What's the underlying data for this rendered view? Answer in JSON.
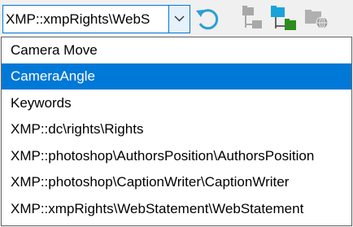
{
  "combo": {
    "value": "XMP::xmpRights\\WebS"
  },
  "toolbar": {
    "icons": {
      "dropdown": "chevron-down-icon",
      "refresh": "refresh-icon",
      "tree_collapsed": "folder-tree-gray-icon",
      "tree_active": "folder-tree-color-icon",
      "network": "network-folder-icon"
    },
    "colors": {
      "accent": "#0078d7",
      "folder_blue": "#1aa3d9",
      "folder_green": "#2e8b1e",
      "folder_gray": "#a8a8a8"
    }
  },
  "options": [
    {
      "label": "Camera Move",
      "selected": false
    },
    {
      "label": "CameraAngle",
      "selected": true
    },
    {
      "label": "Keywords",
      "selected": false
    },
    {
      "label": "XMP::dc\\rights\\Rights",
      "selected": false
    },
    {
      "label": "XMP::photoshop\\AuthorsPosition\\AuthorsPosition",
      "selected": false
    },
    {
      "label": "XMP::photoshop\\CaptionWriter\\CaptionWriter",
      "selected": false
    },
    {
      "label": "XMP::xmpRights\\WebStatement\\WebStatement",
      "selected": false
    }
  ]
}
